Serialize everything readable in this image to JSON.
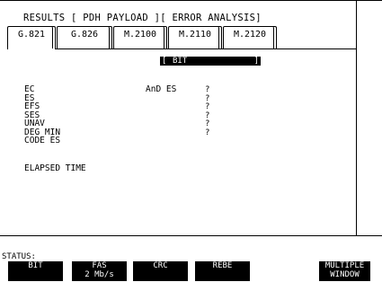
{
  "header": {
    "title": "RESULTS [ PDH PAYLOAD ][ ERROR ANALYSIS]"
  },
  "tabs": [
    {
      "label": "G.821",
      "active": true
    },
    {
      "label": "G.826",
      "active": false
    },
    {
      "label": "M.2100",
      "active": false
    },
    {
      "label": "M.2110",
      "active": false
    },
    {
      "label": "M.2120",
      "active": false
    }
  ],
  "selector": {
    "left_bracket": "[",
    "value": "BIT",
    "right_bracket": "]"
  },
  "results": {
    "rows": [
      {
        "label": "EC",
        "value": "?"
      },
      {
        "label": "ES",
        "value": "?"
      },
      {
        "label": "EFS",
        "value": "?"
      },
      {
        "label": "SES",
        "value": "?"
      },
      {
        "label": "UNAV",
        "value": "?"
      },
      {
        "label": "DEG MIN",
        "value": "?"
      },
      {
        "label": "CODE ES",
        "value": ""
      }
    ],
    "and_es_label": "AnD ES",
    "elapsed_label": "ELAPSED TIME"
  },
  "status": {
    "label": "STATUS:"
  },
  "softkeys": [
    {
      "line1": "BIT",
      "line2": ""
    },
    {
      "line1": "FAS",
      "line2": "2 Mb/s"
    },
    {
      "line1": "CRC",
      "line2": ""
    },
    {
      "line1": "REBE",
      "line2": ""
    },
    {
      "line1": "MULTIPLE",
      "line2": "WINDOW"
    }
  ]
}
